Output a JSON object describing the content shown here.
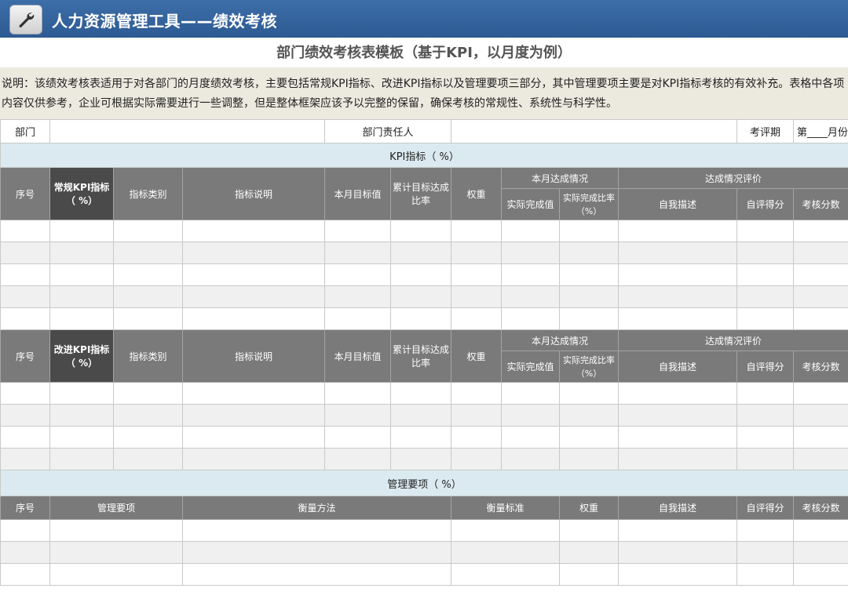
{
  "window": {
    "title": "人力资源管理工具——绩效考核",
    "icon": "wrench-icon"
  },
  "heading": "部门绩效考核表模板（基于KPI，以月度为例）",
  "note": "说明：该绩效考核表适用于对各部门的月度绩效考核，主要包括常规KPI指标、改进KPI指标以及管理要项三部分，其中管理要项主要是对KPI指标考核的有效补充。表格中各项内容仅供参考，企业可根据实际需要进行一些调整，但是整体框架应该予以完整的保留，确保考核的常规性、系统性与科学性。",
  "info": {
    "dept_label": "部门",
    "dept_value": "",
    "owner_label": "部门责任人",
    "owner_value": "",
    "period_label": "考评期",
    "period_value": "第____月份"
  },
  "kpi_section": {
    "title": "KPI指标（      %）"
  },
  "kpi_headers": {
    "seq": "序号",
    "regular_kpi": "常规KPI指标（   %）",
    "improve_kpi": "改进KPI指标（   %）",
    "category": "指标类别",
    "desc": "指标说明",
    "month_target": "本月目标值",
    "cum_rate": "累计目标达成比率",
    "weight": "权重",
    "month_achieve": "本月达成情况",
    "actual_value": "实际完成值",
    "actual_rate": "实际完成比率（%）",
    "eval": "达成情况评价",
    "self_desc": "自我描述",
    "self_score": "自评得分",
    "review_score": "考核分数"
  },
  "mgmt_section": {
    "title": "管理要项（      %）"
  },
  "mgmt_headers": {
    "seq": "序号",
    "item": "管理要项",
    "method": "衡量方法",
    "standard": "衡量标准",
    "weight": "权重",
    "self_desc": "自我描述",
    "self_score": "自评得分",
    "review_score": "考核分数"
  },
  "colors": {
    "titlebar": "#2d5a93",
    "header_bg": "#7a7a7a",
    "section_bg": "#dbeaf0",
    "note_bg": "#ece9df"
  }
}
